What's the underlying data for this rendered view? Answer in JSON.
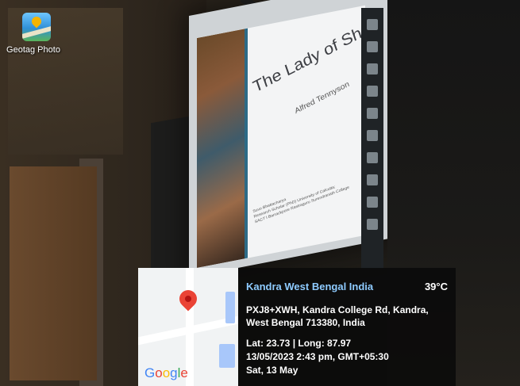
{
  "desktop": {
    "icon_name": "geotag-photo-icon",
    "icon_label": "Geotag Photo"
  },
  "slide": {
    "title": "The Lady of Shalott",
    "author": "Alfred Tennyson",
    "credit_line_1": "Suvo Bhattacharya",
    "credit_line_2": "Research Scholar (PhD) University of Calcutta;",
    "credit_line_3": "SACT I Barrackpore Rastraguru Surendranath College"
  },
  "geotag": {
    "location_title": "Kandra West Bengal India",
    "temperature": "39°C",
    "address": "PXJ8+XWH, Kandra College Rd, Kandra, West Bengal 713380, India",
    "coords": "Lat: 23.73 | Long: 87.97",
    "datetime": "13/05/2023  2:43 pm, GMT+05:30",
    "day": "Sat, 13 May",
    "map_logo": "Google",
    "colors": {
      "title": "#8ecbff",
      "panel_bg": "#0a0a0a",
      "pin": "#ea4335"
    }
  }
}
